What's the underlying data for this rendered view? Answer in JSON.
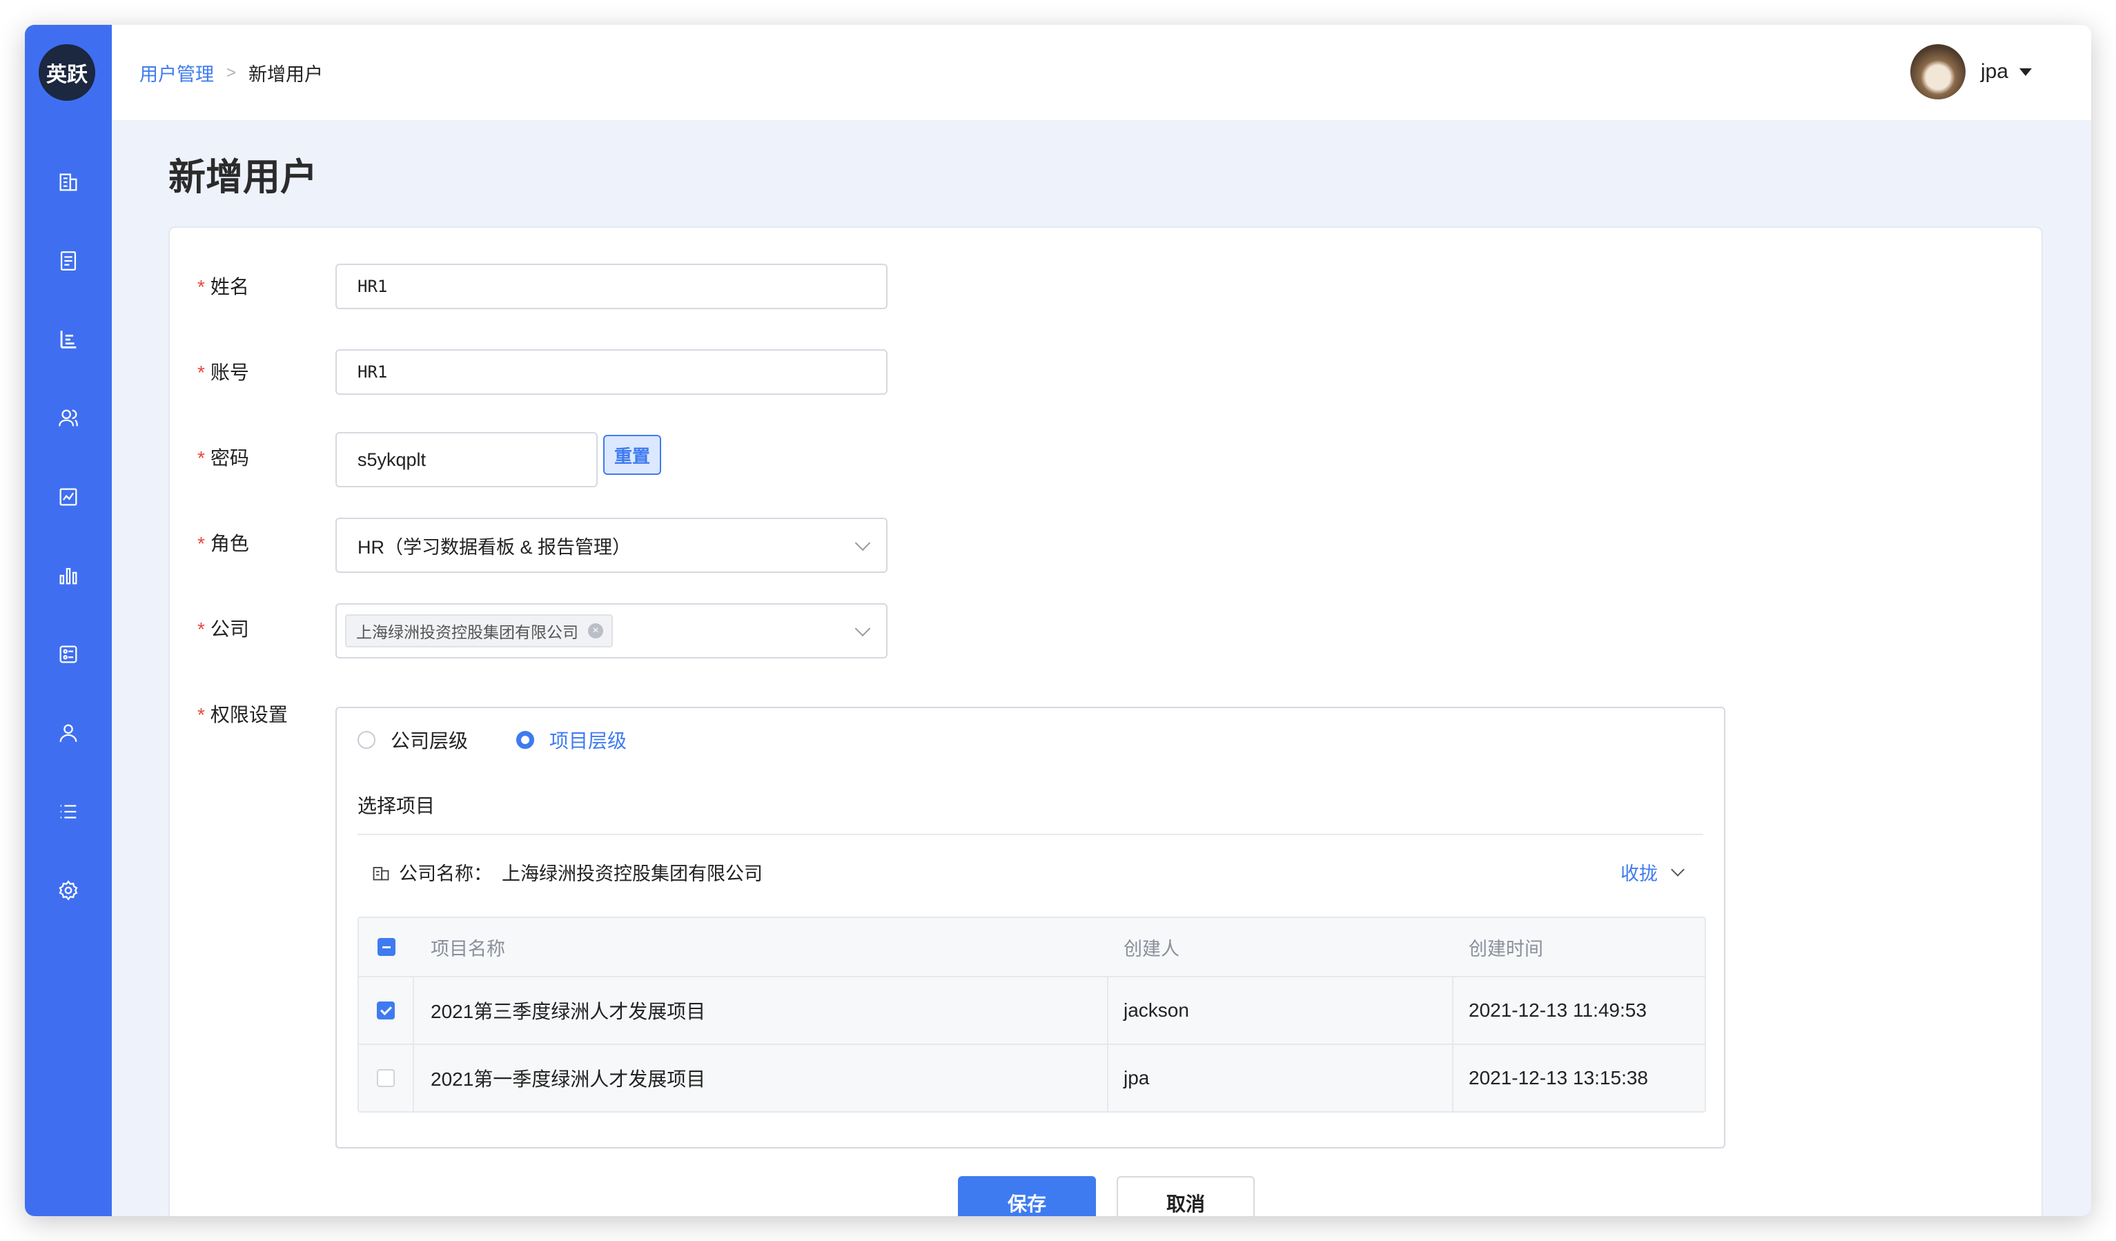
{
  "app": {
    "logo_text": "英跃"
  },
  "sidebar": {
    "items": [
      {
        "icon": "building-icon"
      },
      {
        "icon": "document-icon"
      },
      {
        "icon": "org-chart-icon"
      },
      {
        "icon": "users-icon"
      },
      {
        "icon": "report-icon"
      },
      {
        "icon": "bar-chart-icon"
      },
      {
        "icon": "settings-panel-icon"
      },
      {
        "icon": "user-icon"
      },
      {
        "icon": "list-icon"
      },
      {
        "icon": "gear-icon"
      }
    ]
  },
  "header": {
    "breadcrumb": {
      "parent": "用户管理",
      "current": "新增用户"
    },
    "user": {
      "name": "jpa"
    }
  },
  "page": {
    "title": "新增用户"
  },
  "form": {
    "name": {
      "label": "姓名",
      "value": "HR1"
    },
    "account": {
      "label": "账号",
      "value": "HR1"
    },
    "password": {
      "label": "密码",
      "value": "s5ykqplt",
      "reset_label": "重置"
    },
    "role": {
      "label": "角色",
      "value": "HR（学习数据看板 & 报告管理）"
    },
    "company": {
      "label": "公司",
      "tag": "上海绿洲投资控股集团有限公司"
    },
    "permissions": {
      "label": "权限设置",
      "option_company": "公司层级",
      "option_project": "项目层级",
      "selected": "项目层级",
      "section_title": "选择项目",
      "company_label": "公司名称：",
      "company_name": "上海绿洲投资控股集团有限公司",
      "collapse_label": "收拢",
      "table": {
        "columns": [
          "项目名称",
          "创建人",
          "创建时间"
        ],
        "rows": [
          {
            "checked": true,
            "name": "2021第三季度绿洲人才发展项目",
            "creator": "jackson",
            "created": "2021-12-13 11:49:53"
          },
          {
            "checked": false,
            "name": "2021第一季度绿洲人才发展项目",
            "creator": "jpa",
            "created": "2021-12-13 13:15:38"
          }
        ]
      }
    },
    "required_mark": "*"
  },
  "actions": {
    "save_label": "保存",
    "cancel_label": "取消"
  },
  "colors": {
    "sidebar": "#3f6ff0",
    "accent": "#3f7bf0",
    "required": "#e8473e"
  }
}
